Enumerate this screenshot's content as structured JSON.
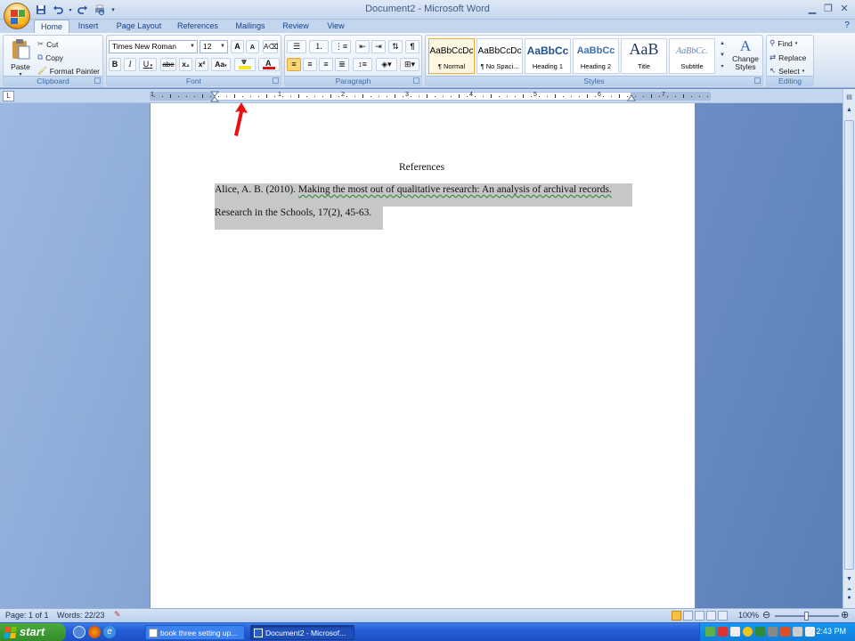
{
  "window": {
    "title": "Document2 - Microsoft Word",
    "quick_access": [
      "save-icon",
      "undo-icon",
      "redo-icon",
      "customize-icon"
    ]
  },
  "tabs": [
    "Home",
    "Insert",
    "Page Layout",
    "References",
    "Mailings",
    "Review",
    "View"
  ],
  "active_tab": "Home",
  "clipboard": {
    "paste": "Paste",
    "cut": "Cut",
    "copy": "Copy",
    "format_painter": "Format Painter",
    "label": "Clipboard"
  },
  "font": {
    "name": "Times New Roman",
    "size": "12",
    "label": "Font",
    "bold": "B",
    "italic": "I",
    "underline": "U",
    "strike": "abe",
    "subscript": "x₂",
    "superscript": "x²",
    "change_case": "Aa",
    "grow": "A",
    "shrink": "A",
    "highlight_color": "#f5e62b",
    "font_color": "#e01010"
  },
  "paragraph": {
    "label": "Paragraph",
    "pilcrow": "¶"
  },
  "styles": {
    "label": "Styles",
    "items": [
      {
        "preview": "AaBbCcDc",
        "name": "¶ Normal"
      },
      {
        "preview": "AaBbCcDc",
        "name": "¶ No Spaci..."
      },
      {
        "preview": "AaBbCc",
        "name": "Heading 1"
      },
      {
        "preview": "AaBbCc",
        "name": "Heading 2"
      },
      {
        "preview": "AaB",
        "name": "Title"
      },
      {
        "preview": "AaBbCc.",
        "name": "Subtitle"
      }
    ],
    "change_styles": "Change Styles"
  },
  "editing": {
    "label": "Editing",
    "find": "Find",
    "replace": "Replace",
    "select": "Select"
  },
  "ruler": {
    "numbers": [
      "1",
      "1",
      "2",
      "3",
      "4",
      "5",
      "6",
      "7"
    ]
  },
  "document": {
    "heading": "References",
    "line1_plain": "Alice, A. B. (2010).",
    "line1_title": "Making the most out of qualitative research:  An analysis of archival records.",
    "line2": "Research in the Schools, 17(2), 45-63."
  },
  "statusbar": {
    "page": "Page: 1 of 1",
    "words": "Words: 22/23",
    "zoom": "100%"
  },
  "taskbar": {
    "start": "start",
    "items": [
      "book three setting up...",
      "Document2 - Microsof..."
    ],
    "clock": "2:43 PM"
  }
}
